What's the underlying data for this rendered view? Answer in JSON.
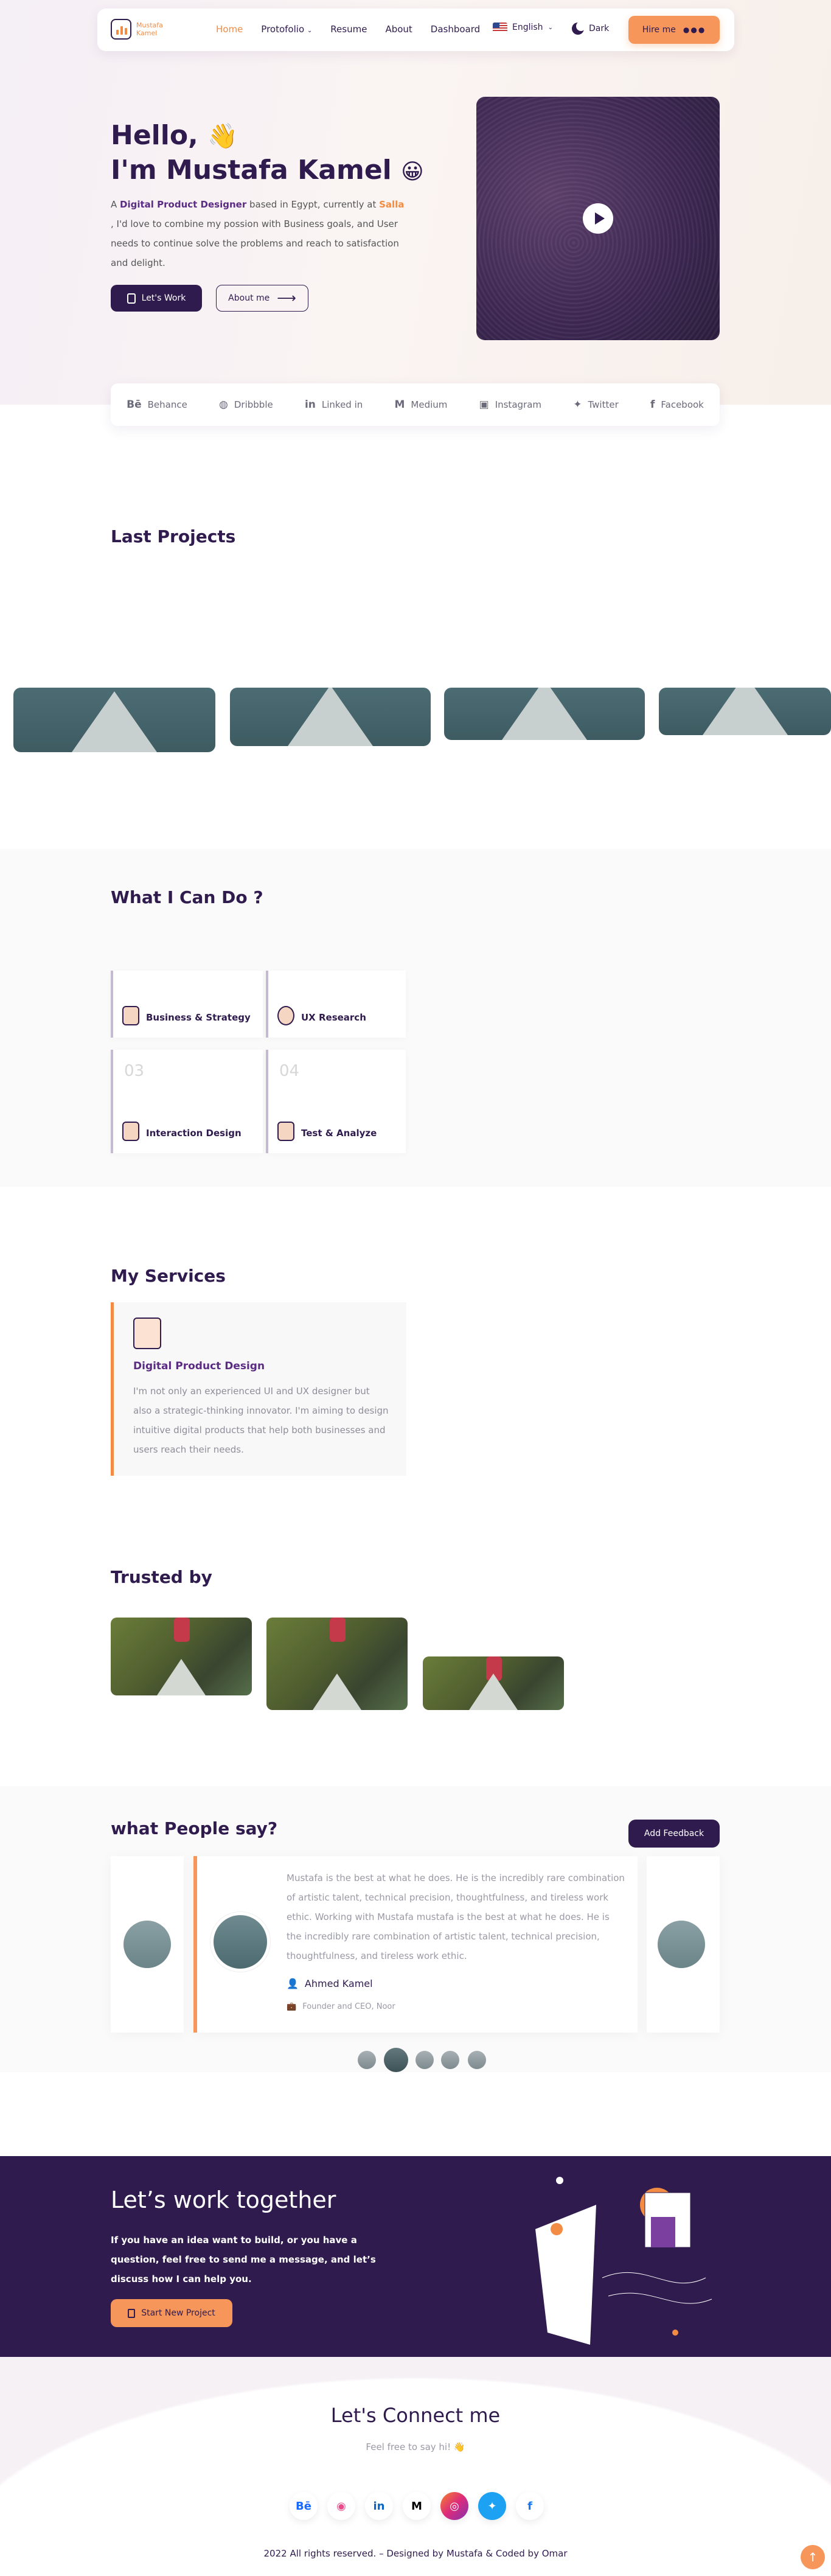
{
  "brand": {
    "line1": "Mustafa",
    "line2": "Kamel"
  },
  "nav": {
    "items": [
      "Home",
      "Protofolio",
      "Resume",
      "About",
      "Dashboard"
    ],
    "language": "English",
    "dark": "Dark",
    "hire": "Hire me"
  },
  "hero": {
    "hello": "Hello,",
    "name": "I'm Mustafa Kamel",
    "bio_a": "A ",
    "bio_role": "Digital Product Designer",
    "bio_b": " based in Egypt, currently at ",
    "bio_company": "Salla",
    "bio_c": " , I'd love to combine my possion with Business goals, and User needs to continue solve the problems and reach to satisfaction and delight.",
    "work_btn": "Let's Work",
    "about_btn": "About me"
  },
  "social": [
    "Behance",
    "Dribbble",
    "Linked in",
    "Medium",
    "Instagram",
    "Twitter",
    "Facebook"
  ],
  "projects": {
    "title": "Last Projects"
  },
  "cando": {
    "title": "What I Can Do ?",
    "items": [
      {
        "num": "",
        "label": "Business & Strategy"
      },
      {
        "num": "",
        "label": "UX Research"
      },
      {
        "num": "03",
        "label": "Interaction Design"
      },
      {
        "num": "04",
        "label": "Test & Analyze"
      }
    ]
  },
  "services": {
    "title": "My Services",
    "card_title": "Digital Product Design",
    "card_text": "I'm not only an experienced UI and UX designer but also a strategic-thinking innovator. I'm aiming to design intuitive digital products that help both businesses and users reach their needs."
  },
  "trusted": {
    "title": "Trusted by"
  },
  "testimonials": {
    "title": "what People say?",
    "add": "Add Feedback",
    "quote": "Mustafa is the best at what he does. He is the incredibly rare combination of artistic talent, technical precision, thoughtfulness, and tireless work ethic. Working with Mustafa mustafa is the best at what he does. He is the incredibly rare combination of artistic talent, technical precision, thoughtfulness, and tireless work ethic.",
    "name": "Ahmed Kamel",
    "role": "Founder and CEO, Noor"
  },
  "cta": {
    "title": "Let’s work together",
    "text": "If you have an idea want to build, or you have a question, feel free to send me a message, and let’s discuss how I can help you.",
    "button": "Start New Project"
  },
  "connect": {
    "title": "Let's Connect me",
    "sub": "Feel free to say hi!",
    "icons": [
      "Bē",
      "◉",
      "in",
      "M",
      "◎",
      "✦",
      "f"
    ]
  },
  "footer": {
    "copy": "2022 All rights reserved. – Designed by Mustafa & Coded by Omar"
  },
  "colors": {
    "primary": "#2f1b4d",
    "accent": "#f28b43",
    "button": "#f6965b"
  }
}
